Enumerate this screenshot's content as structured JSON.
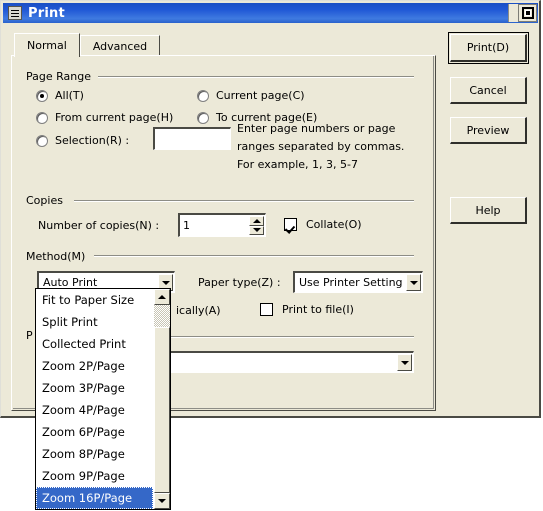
{
  "window": {
    "title": "Print",
    "system_menu_icon": "system-menu-icon",
    "maximize_restore_icon": "restore-window-icon"
  },
  "tabs": [
    {
      "label": "Normal",
      "active": true
    },
    {
      "label": "Advanced",
      "active": false
    }
  ],
  "page_range": {
    "group_label": "Page Range",
    "options": [
      {
        "label": "All(T)",
        "checked": true
      },
      {
        "label": "Current page(C)",
        "checked": false
      },
      {
        "label": "From current page(H)",
        "checked": false
      },
      {
        "label": "To current page(E)",
        "checked": false
      },
      {
        "label": "Selection(R) :",
        "checked": false
      }
    ],
    "selection_value": "",
    "hint_lines": [
      "Enter page numbers or page",
      "ranges separated by commas.",
      "For example, 1, 3, 5-7"
    ]
  },
  "copies": {
    "group_label": "Copies",
    "count_label": "Number of copies(N) :",
    "count_value": "1",
    "collate_label": "Collate(O)",
    "collate_checked": true
  },
  "method": {
    "group_label": "Method(M)",
    "selected": "Auto Print",
    "paper_type_label": "Paper type(Z) :",
    "paper_type_value": "Use Printer Setting",
    "rotate_label_visible": "ically(A)",
    "print_to_file_label": "Print to file(I)",
    "print_to_file_checked": false,
    "dropdown_items": [
      {
        "label": "Fit to Paper Size",
        "selected": false
      },
      {
        "label": "Split Print",
        "selected": false
      },
      {
        "label": "Collected Print",
        "selected": false
      },
      {
        "label": "Zoom 2P/Page",
        "selected": false
      },
      {
        "label": "Zoom 3P/Page",
        "selected": false
      },
      {
        "label": "Zoom 4P/Page",
        "selected": false
      },
      {
        "label": "Zoom 6P/Page",
        "selected": false
      },
      {
        "label": "Zoom 8P/Page",
        "selected": false
      },
      {
        "label": "Zoom 9P/Page",
        "selected": false
      },
      {
        "label": "Zoom 16P/Page",
        "selected": true
      }
    ]
  },
  "bottom_group": {
    "group_label_visible": "P",
    "combo_value": ""
  },
  "buttons": [
    {
      "label": "Print(D)",
      "default": true
    },
    {
      "label": "Cancel",
      "default": false
    },
    {
      "label": "Preview",
      "default": false
    },
    {
      "label": "Help",
      "default": false
    }
  ],
  "colors": {
    "titlebar_blue": "#2159d6",
    "dialog_face": "#ece9d8",
    "selection_blue": "#3568c8",
    "field_white": "#ffffff",
    "shadow": "#4a4a44"
  }
}
